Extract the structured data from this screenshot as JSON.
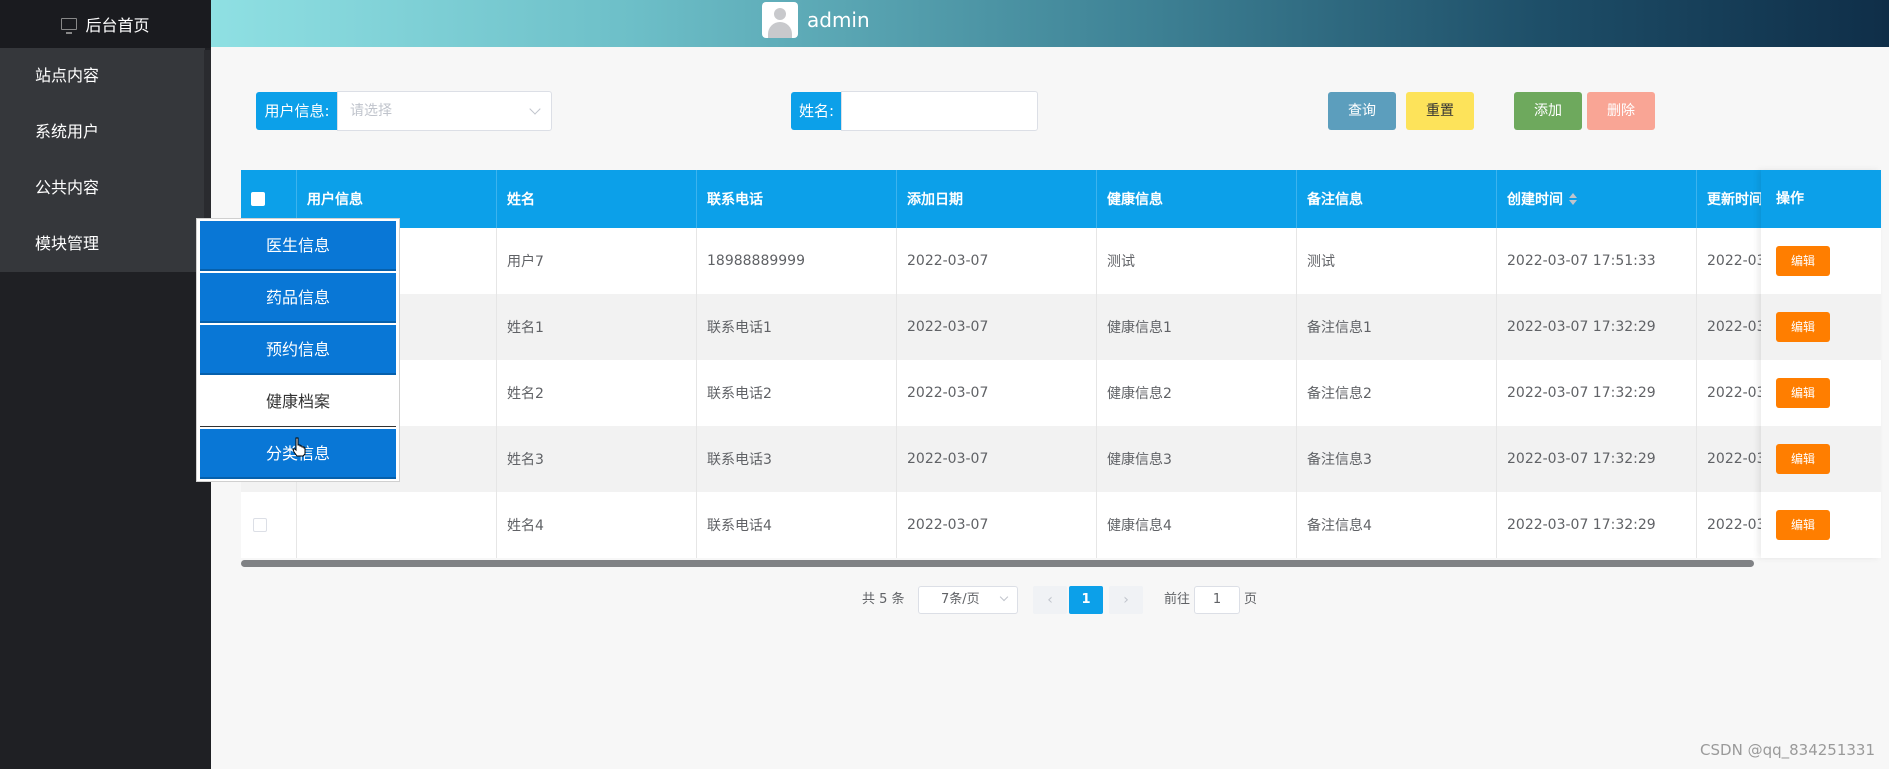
{
  "sidebar": {
    "home": "后台首页",
    "items": [
      {
        "label": "站点内容"
      },
      {
        "label": "系统用户"
      },
      {
        "label": "公共内容"
      },
      {
        "label": "模块管理"
      }
    ]
  },
  "header": {
    "username": "admin"
  },
  "search": {
    "user_info_label": "用户信息:",
    "user_info_placeholder": "请选择",
    "name_label": "姓名:",
    "name_value": ""
  },
  "buttons": {
    "query": "查询",
    "reset": "重置",
    "add": "添加",
    "delete": "删除"
  },
  "table": {
    "columns": [
      "用户信息",
      "姓名",
      "联系电话",
      "添加日期",
      "健康信息",
      "备注信息",
      "创建时间",
      "更新时间"
    ],
    "op_header": "操作",
    "edit_label": "编辑",
    "rows": [
      {
        "user": "",
        "name": "用户7",
        "phone": "18988889999",
        "date": "2022-03-07",
        "health": "测试",
        "remark": "测试",
        "created": "2022-03-07 17:51:33",
        "updated": "2022-03"
      },
      {
        "user": "",
        "name": "姓名1",
        "phone": "联系电话1",
        "date": "2022-03-07",
        "health": "健康信息1",
        "remark": "备注信息1",
        "created": "2022-03-07 17:32:29",
        "updated": "2022-03"
      },
      {
        "user": "",
        "name": "姓名2",
        "phone": "联系电话2",
        "date": "2022-03-07",
        "health": "健康信息2",
        "remark": "备注信息2",
        "created": "2022-03-07 17:32:29",
        "updated": "2022-03"
      },
      {
        "user": "",
        "name": "姓名3",
        "phone": "联系电话3",
        "date": "2022-03-07",
        "health": "健康信息3",
        "remark": "备注信息3",
        "created": "2022-03-07 17:32:29",
        "updated": "2022-03"
      },
      {
        "user": "",
        "name": "姓名4",
        "phone": "联系电话4",
        "date": "2022-03-07",
        "health": "健康信息4",
        "remark": "备注信息4",
        "created": "2022-03-07 17:32:29",
        "updated": "2022-03"
      }
    ]
  },
  "pagination": {
    "total": "共 5 条",
    "page_size": "7条/页",
    "current": "1",
    "goto_label": "前往",
    "goto_value": "1",
    "page_suffix": "页",
    "prev_icon": "chevron-left-icon",
    "next_icon": "chevron-right-icon"
  },
  "dropdown": {
    "items": [
      {
        "label": "医生信息",
        "active": true
      },
      {
        "label": "药品信息",
        "active": true
      },
      {
        "label": "预约信息",
        "active": true
      },
      {
        "label": "健康档案",
        "active": false
      },
      {
        "label": "分类信息",
        "active": true
      }
    ]
  },
  "watermark": "CSDN @qq_834251331",
  "colors": {
    "primary": "#0ca0e9",
    "query_btn": "#5c9ebd",
    "reset_btn": "#fde35a",
    "add_btn": "#6ea95d",
    "delete_btn": "#f9a595",
    "edit_btn": "#ff7e00",
    "dropdown_active": "#0977d6"
  }
}
